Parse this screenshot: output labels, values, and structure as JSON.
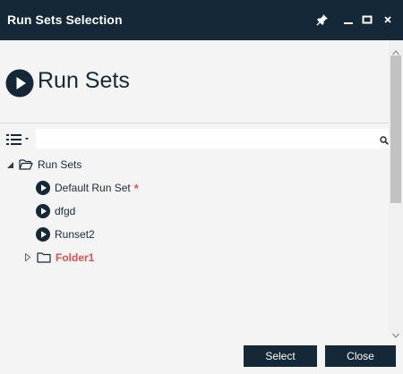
{
  "window": {
    "title": "Run Sets Selection",
    "controls": [
      "pin-icon",
      "minimize-icon",
      "maximize-icon",
      "close-icon"
    ]
  },
  "header": {
    "title": "Run Sets",
    "icon": "play-circle-icon"
  },
  "toolbar": {
    "menu_icon": "list-menu-icon",
    "search_value": "",
    "search_placeholder": "",
    "search_icon": "search-icon"
  },
  "tree": {
    "root": {
      "label": "Run Sets",
      "expanded": true,
      "icon": "folder-open-icon"
    },
    "items": [
      {
        "label": "Default Run Set",
        "icon": "play-circle-icon",
        "modified_marker": "*"
      },
      {
        "label": "dfgd",
        "icon": "play-circle-icon"
      },
      {
        "label": "Runset2",
        "icon": "play-circle-icon"
      }
    ],
    "folder": {
      "label": "Folder1",
      "expanded": false,
      "icon": "folder-icon"
    }
  },
  "buttons": {
    "select": "Select",
    "close": "Close"
  },
  "colors": {
    "titlebar": "#142837",
    "button": "#142837",
    "folder_label": "#e05050",
    "marker": "#e05050"
  }
}
